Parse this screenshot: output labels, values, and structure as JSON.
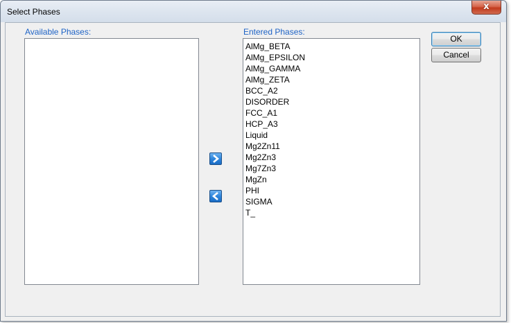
{
  "window": {
    "title": "Select Phases",
    "close_glyph": "x"
  },
  "available": {
    "label": "Available Phases:",
    "items": []
  },
  "entered": {
    "label": "Entered Phases:",
    "items": [
      "AlMg_BETA",
      "AlMg_EPSILON",
      "AlMg_GAMMA",
      "AlMg_ZETA",
      "BCC_A2",
      "DISORDER",
      "FCC_A1",
      "HCP_A3",
      "Liquid",
      "Mg2Zn11",
      "Mg2Zn3",
      "Mg7Zn3",
      "MgZn",
      "PHI",
      "SIGMA",
      "T_"
    ]
  },
  "buttons": {
    "ok": "OK",
    "cancel": "Cancel"
  },
  "icons": {
    "move_right": "chevron-right-icon",
    "move_left": "chevron-left-icon"
  },
  "colors": {
    "label_blue": "#1e63c6",
    "arrow_button_blue": "#2f86dc"
  }
}
